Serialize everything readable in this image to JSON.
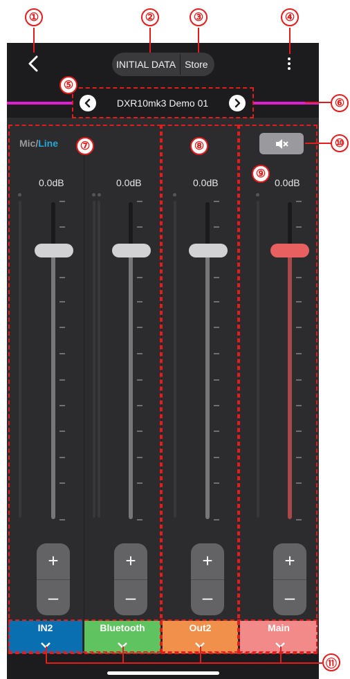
{
  "header": {
    "back_icon": "chevron-left-icon",
    "initial_data_label": "INITIAL DATA",
    "store_label": "Store",
    "menu_icon": "more-vertical-icon"
  },
  "scene": {
    "name": "DXR10mk3 Demo 01",
    "prev_icon": "chevron-left-circle-icon",
    "next_icon": "chevron-right-circle-icon"
  },
  "input_title": {
    "mic": "Mic",
    "slash": "/",
    "line": "Line"
  },
  "mute_icon": "speaker-muted-icon",
  "channels": [
    {
      "name": "IN2",
      "level": "0.0dB",
      "color": "#0a6fb0",
      "fader_level": 0.83,
      "plus": "+",
      "minus": "–"
    },
    {
      "name": "Bluetooth",
      "level": "0.0dB",
      "color": "#5fc45f",
      "fader_level": 0.83,
      "plus": "+",
      "minus": "–"
    },
    {
      "name": "Out2",
      "level": "0.0dB",
      "color": "#f1904b",
      "fader_level": 0.83,
      "plus": "+",
      "minus": "–"
    },
    {
      "name": "Main",
      "level": "0.0dB",
      "color": "#f28a8a",
      "fader_level": 0.83,
      "plus": "+",
      "minus": "–"
    }
  ],
  "callouts": [
    "①",
    "②",
    "③",
    "④",
    "⑤",
    "⑥",
    "⑦",
    "⑧",
    "⑨",
    "⑩",
    "⑪"
  ]
}
